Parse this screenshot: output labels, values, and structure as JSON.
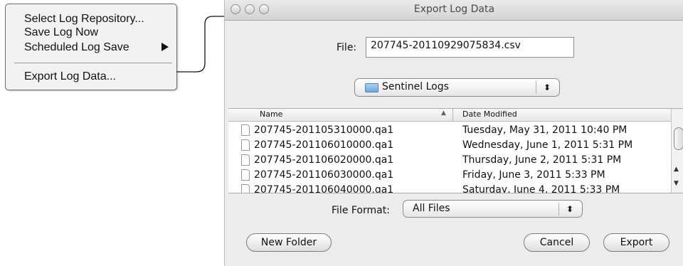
{
  "context_menu": {
    "items": [
      {
        "label": "Select Log Repository..."
      },
      {
        "label": "Save Log Now"
      },
      {
        "label": "Scheduled Log Save",
        "submenu_icon": "triangle-right"
      },
      {
        "label": "Export Log Data..."
      }
    ]
  },
  "dialog": {
    "title": "Export Log Data",
    "file_label": "File:",
    "file_value": "207745-20110929075834.csv",
    "folder": "Sentinel Logs",
    "columns": {
      "name": "Name",
      "date": "Date Modified"
    },
    "files": [
      {
        "name": "207745-201105310000.qa1",
        "date": "Tuesday, May 31, 2011 10:40 PM"
      },
      {
        "name": "207745-201106010000.qa1",
        "date": "Wednesday, June 1, 2011 5:31 PM"
      },
      {
        "name": "207745-201106020000.qa1",
        "date": "Thursday, June 2, 2011 5:31 PM"
      },
      {
        "name": "207745-201106030000.qa1",
        "date": "Friday, June 3, 2011 5:33 PM"
      },
      {
        "name": "207745-201106040000.qa1",
        "date": "Saturday, June 4, 2011 5:33 PM"
      }
    ],
    "format_label": "File Format:",
    "format_value": "All Files",
    "buttons": {
      "new_folder": "New Folder",
      "cancel": "Cancel",
      "export": "Export"
    }
  },
  "colors": {
    "menu_bg": "#f2f2f2",
    "dialog_bg": "#ececec",
    "folder_icon": "#6fa9dc"
  }
}
